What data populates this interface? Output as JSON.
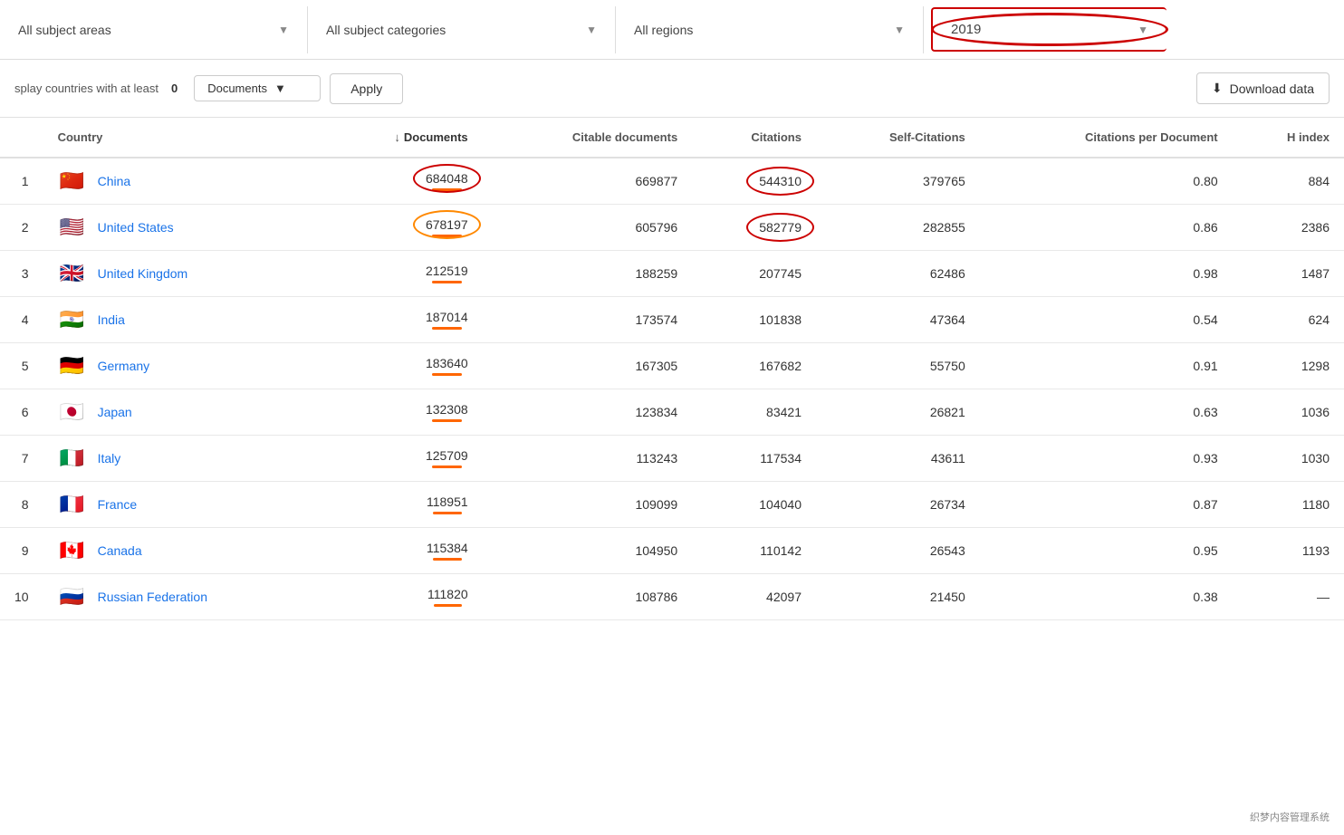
{
  "filters": {
    "subject_areas": {
      "label": "All subject areas",
      "placeholder": "All subject areas"
    },
    "subject_categories": {
      "label": "All subject categories",
      "placeholder": "All subject categories"
    },
    "regions": {
      "label": "All regions",
      "placeholder": "All regions"
    },
    "year": {
      "label": "2019"
    }
  },
  "controls": {
    "display_prefix": "splay countries with at least",
    "min_value": "0",
    "doc_type": "Documents",
    "apply_label": "Apply",
    "download_label": "Download data"
  },
  "table": {
    "columns": [
      {
        "key": "rank",
        "label": ""
      },
      {
        "key": "country",
        "label": "Country"
      },
      {
        "key": "documents",
        "label": "Documents",
        "sorted": true
      },
      {
        "key": "citable_docs",
        "label": "Citable documents"
      },
      {
        "key": "citations",
        "label": "Citations"
      },
      {
        "key": "self_citations",
        "label": "Self-Citations"
      },
      {
        "key": "citations_per_doc",
        "label": "Citations per Document"
      },
      {
        "key": "h_index",
        "label": "H index"
      }
    ],
    "rows": [
      {
        "rank": "1",
        "country": "China",
        "flag": "🇨🇳",
        "documents": "684048",
        "citable_docs": "669877",
        "citations": "544310",
        "self_citations": "379765",
        "citations_per_doc": "0.80",
        "h_index": "884",
        "circle_docs": "red",
        "circle_citations": "red"
      },
      {
        "rank": "2",
        "country": "United States",
        "flag": "🇺🇸",
        "documents": "678197",
        "citable_docs": "605796",
        "citations": "582779",
        "self_citations": "282855",
        "citations_per_doc": "0.86",
        "h_index": "2386",
        "circle_docs": "orange",
        "circle_citations": "red"
      },
      {
        "rank": "3",
        "country": "United Kingdom",
        "flag": "🇬🇧",
        "documents": "212519",
        "citable_docs": "188259",
        "citations": "207745",
        "self_citations": "62486",
        "citations_per_doc": "0.98",
        "h_index": "1487"
      },
      {
        "rank": "4",
        "country": "India",
        "flag": "🇮🇳",
        "documents": "187014",
        "citable_docs": "173574",
        "citations": "101838",
        "self_citations": "47364",
        "citations_per_doc": "0.54",
        "h_index": "624"
      },
      {
        "rank": "5",
        "country": "Germany",
        "flag": "🇩🇪",
        "documents": "183640",
        "citable_docs": "167305",
        "citations": "167682",
        "self_citations": "55750",
        "citations_per_doc": "0.91",
        "h_index": "1298"
      },
      {
        "rank": "6",
        "country": "Japan",
        "flag": "🇯🇵",
        "documents": "132308",
        "citable_docs": "123834",
        "citations": "83421",
        "self_citations": "26821",
        "citations_per_doc": "0.63",
        "h_index": "1036"
      },
      {
        "rank": "7",
        "country": "Italy",
        "flag": "🇮🇹",
        "documents": "125709",
        "citable_docs": "113243",
        "citations": "117534",
        "self_citations": "43611",
        "citations_per_doc": "0.93",
        "h_index": "1030"
      },
      {
        "rank": "8",
        "country": "France",
        "flag": "🇫🇷",
        "documents": "118951",
        "citable_docs": "109099",
        "citations": "104040",
        "self_citations": "26734",
        "citations_per_doc": "0.87",
        "h_index": "1180"
      },
      {
        "rank": "9",
        "country": "Canada",
        "flag": "🇨🇦",
        "documents": "115384",
        "citable_docs": "104950",
        "citations": "110142",
        "self_citations": "26543",
        "citations_per_doc": "0.95",
        "h_index": "1193"
      },
      {
        "rank": "10",
        "country": "Russian Federation",
        "flag": "🇷🇺",
        "documents": "111820",
        "citable_docs": "108786",
        "citations": "42097",
        "self_citations": "21450",
        "citations_per_doc": "0.38",
        "h_index": "—"
      }
    ]
  },
  "watermark": "织梦内容管理系统"
}
